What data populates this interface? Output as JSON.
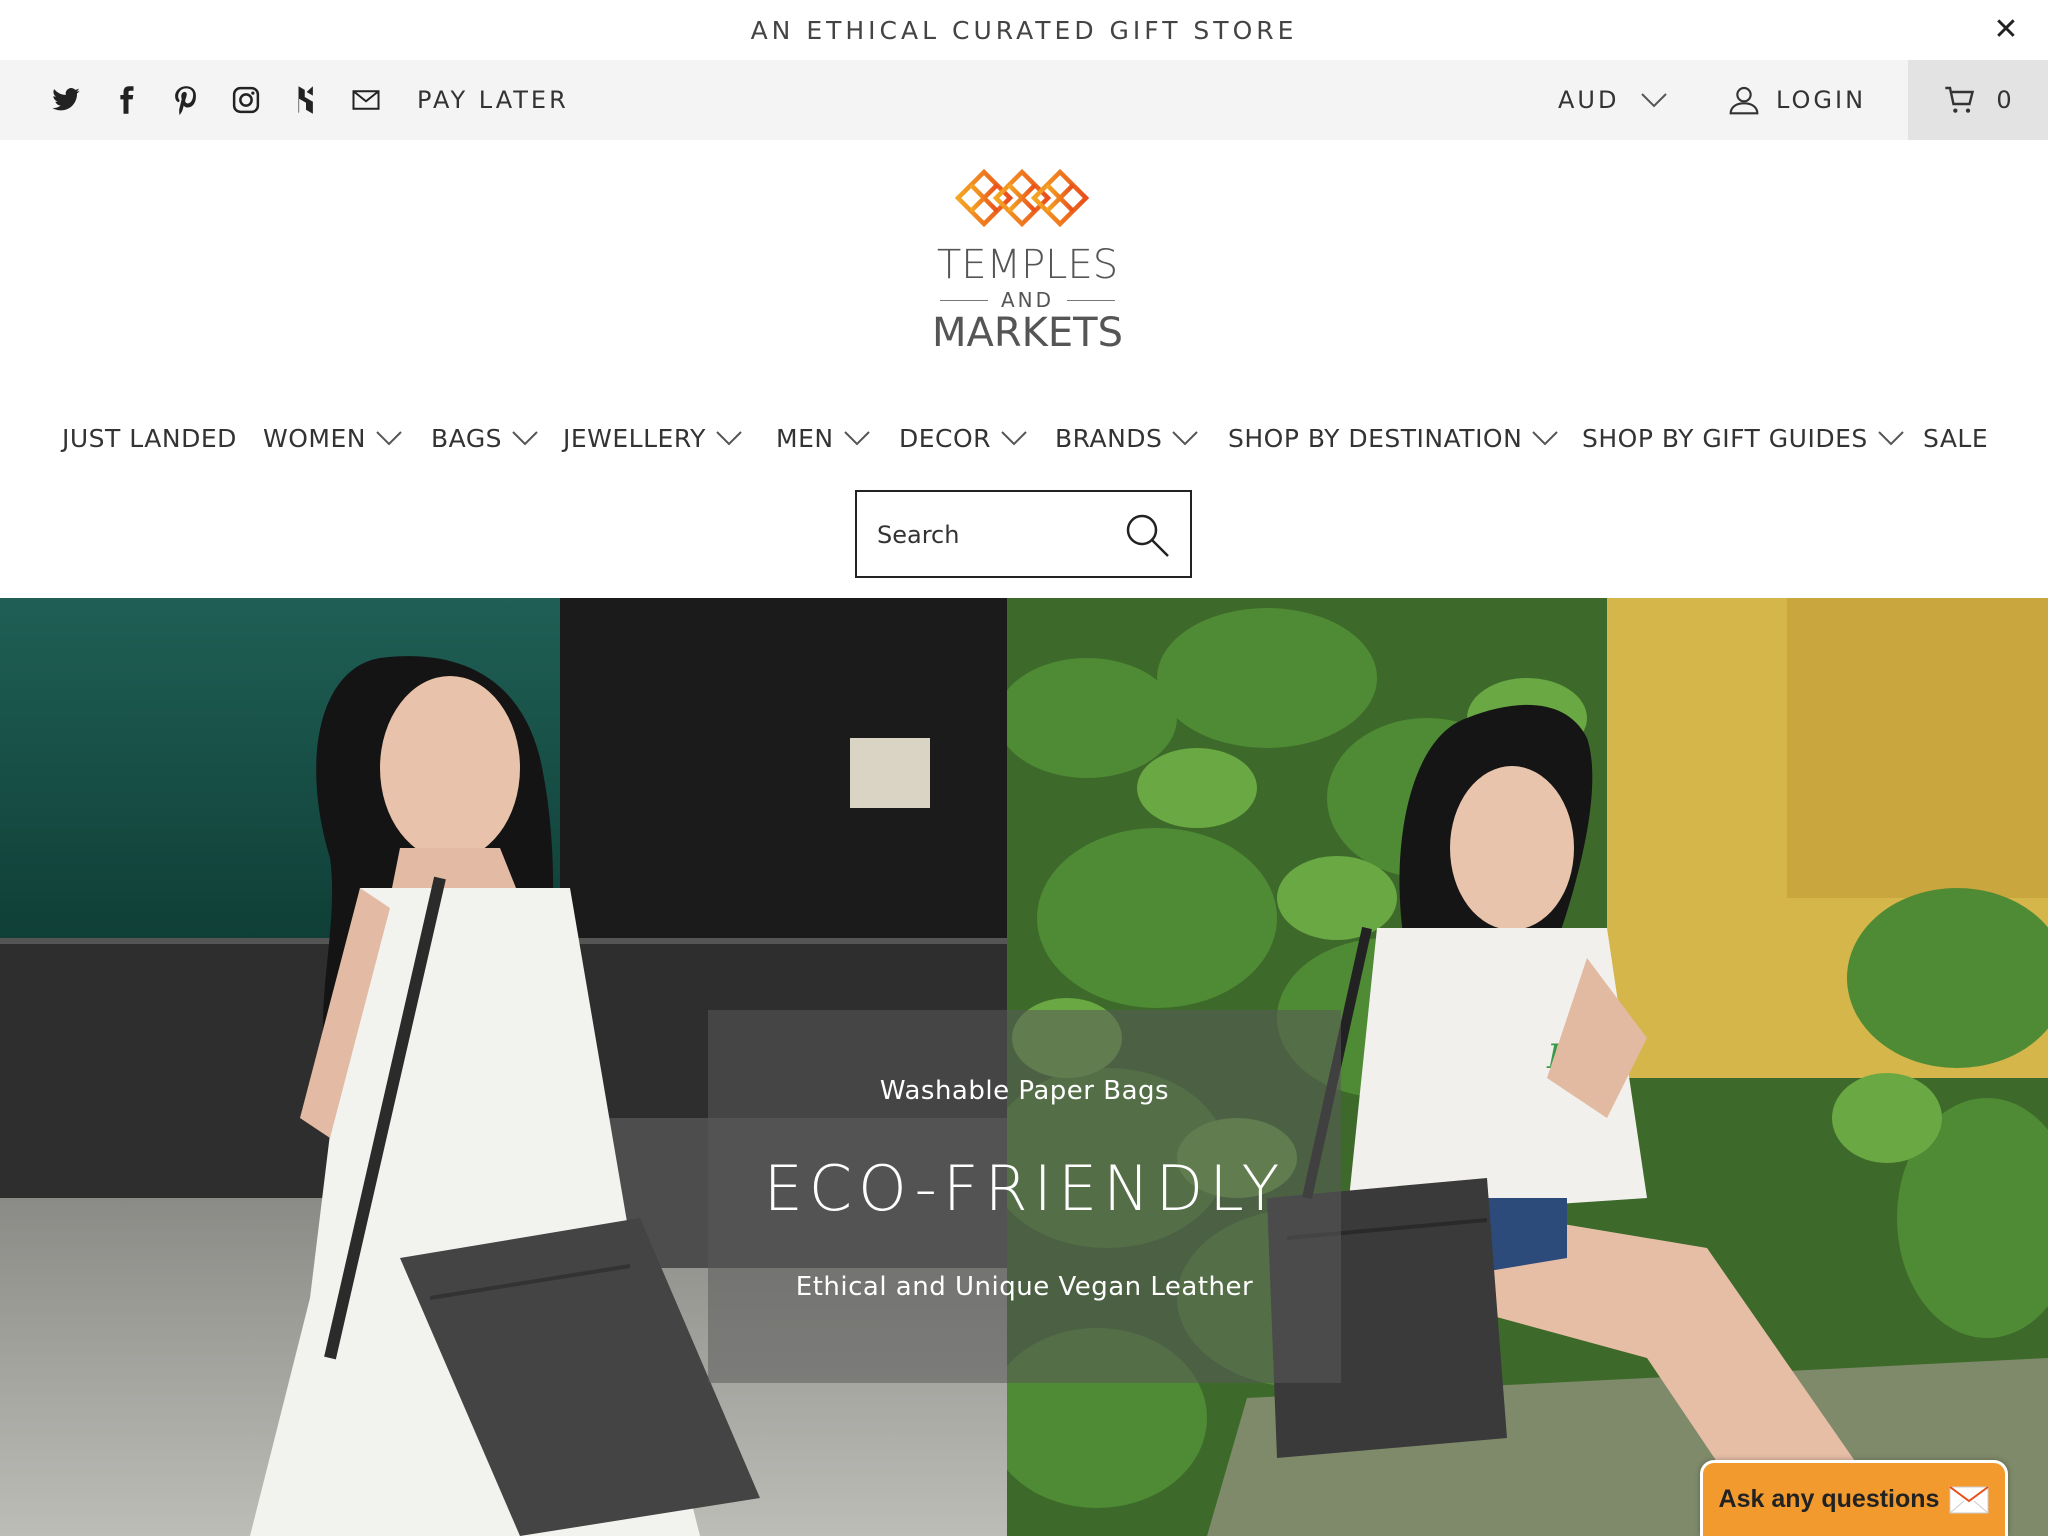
{
  "announcement": {
    "text": "AN ETHICAL CURATED GIFT STORE",
    "close_label": "✕"
  },
  "topbar": {
    "social_icons": [
      "twitter-icon",
      "facebook-icon",
      "pinterest-icon",
      "instagram-icon",
      "houzz-icon",
      "mail-icon"
    ],
    "pay_later": "PAY LATER",
    "currency": "AUD",
    "login": "LOGIN",
    "cart_count": "0"
  },
  "logo": {
    "line1": "TEMPLES",
    "and": "AND",
    "line2": "MARKETS",
    "colors": [
      "#f28c28",
      "#e94e1b"
    ]
  },
  "nav": {
    "items": [
      {
        "label": "JUST LANDED",
        "has_dropdown": false
      },
      {
        "label": "WOMEN",
        "has_dropdown": true
      },
      {
        "label": "BAGS",
        "has_dropdown": true
      },
      {
        "label": "JEWELLERY",
        "has_dropdown": true
      },
      {
        "label": "MEN",
        "has_dropdown": true
      },
      {
        "label": "DECOR",
        "has_dropdown": true
      },
      {
        "label": "BRANDS",
        "has_dropdown": true
      },
      {
        "label": "SHOP BY DESTINATION",
        "has_dropdown": true
      },
      {
        "label": "SHOP BY GIFT GUIDES",
        "has_dropdown": true
      },
      {
        "label": "SALE",
        "has_dropdown": false
      }
    ]
  },
  "search": {
    "placeholder": "Search",
    "value": ""
  },
  "hero": {
    "subtitle": "Washable Paper Bags",
    "title": "ECO-FRIENDLY",
    "description": "Ethical and Unique Vegan Leather"
  },
  "chat": {
    "label": "Ask any questions",
    "accent": "#f29a2e"
  },
  "colors": {
    "topbar_bg": "#f4f4f4",
    "cart_bg": "#e3e3e3",
    "text": "#333333"
  }
}
